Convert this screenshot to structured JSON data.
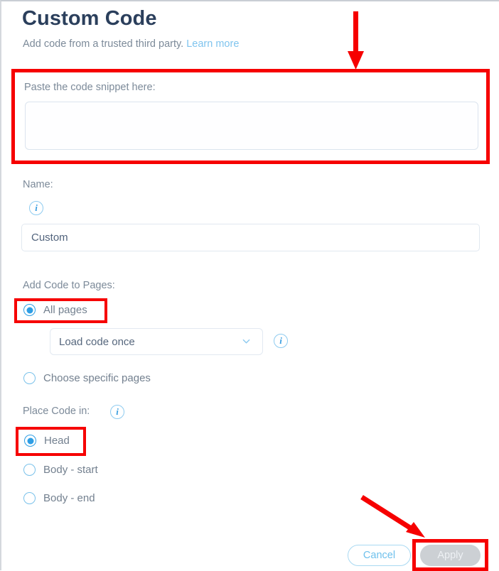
{
  "header": {
    "title": "Custom Code",
    "subtitle_text": "Add code from a trusted third party.",
    "subtitle_link": "Learn more"
  },
  "code_section": {
    "label": "Paste the code snippet here:",
    "value": "",
    "placeholder": ""
  },
  "name_section": {
    "label": "Name:",
    "info_icon": "info-icon",
    "value": "Custom"
  },
  "pages_section": {
    "label": "Add Code to Pages:",
    "options": [
      {
        "label": "All pages",
        "selected": true
      },
      {
        "label": "Choose specific pages",
        "selected": false
      }
    ],
    "load_select": {
      "value": "Load code once",
      "chevron_icon": "chevron-down-icon",
      "info_icon": "info-icon"
    }
  },
  "place_section": {
    "label": "Place Code in:",
    "info_icon": "info-icon",
    "options": [
      {
        "label": "Head",
        "selected": true
      },
      {
        "label": "Body - start",
        "selected": false
      },
      {
        "label": "Body - end",
        "selected": false
      }
    ]
  },
  "footer": {
    "cancel_label": "Cancel",
    "apply_label": "Apply",
    "apply_disabled": true
  },
  "annotations": {
    "highlight_color": "#f60000",
    "boxes": [
      "code-snippet-box",
      "all-pages-radio",
      "head-radio",
      "apply-button"
    ],
    "arrows": [
      "arrow-to-code-box",
      "arrow-to-apply-button"
    ]
  }
}
